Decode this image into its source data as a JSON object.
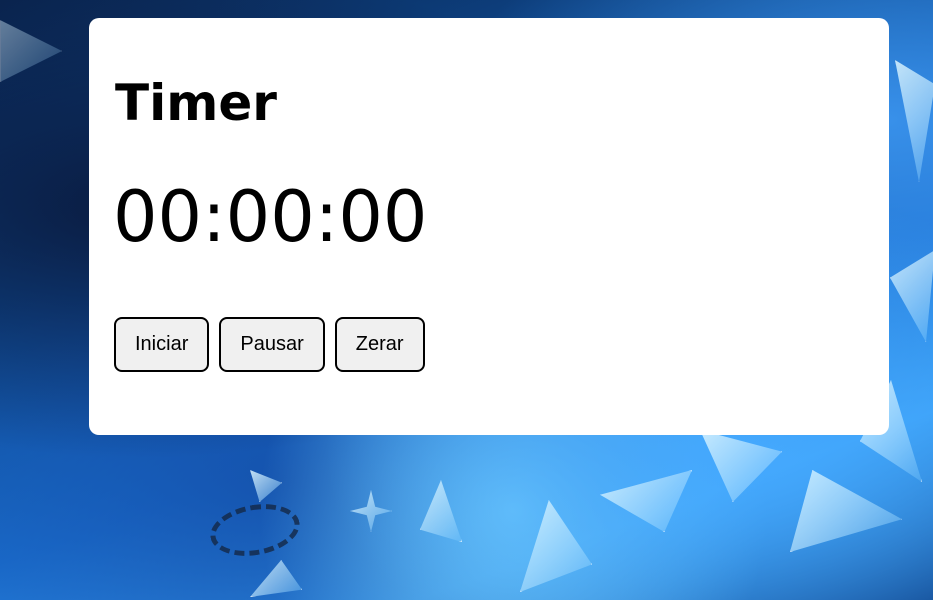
{
  "timer": {
    "title": "Timer",
    "display": "00:00:00"
  },
  "controls": {
    "start_label": "Iniciar",
    "pause_label": "Pausar",
    "reset_label": "Zerar"
  },
  "colors": {
    "panel_background": "#ffffff",
    "button_background": "#f0f0f0",
    "button_border": "#000000",
    "text": "#000000",
    "background_accent": "#1b6fd0"
  },
  "background": {
    "description_icon": "ice-shards-background"
  }
}
